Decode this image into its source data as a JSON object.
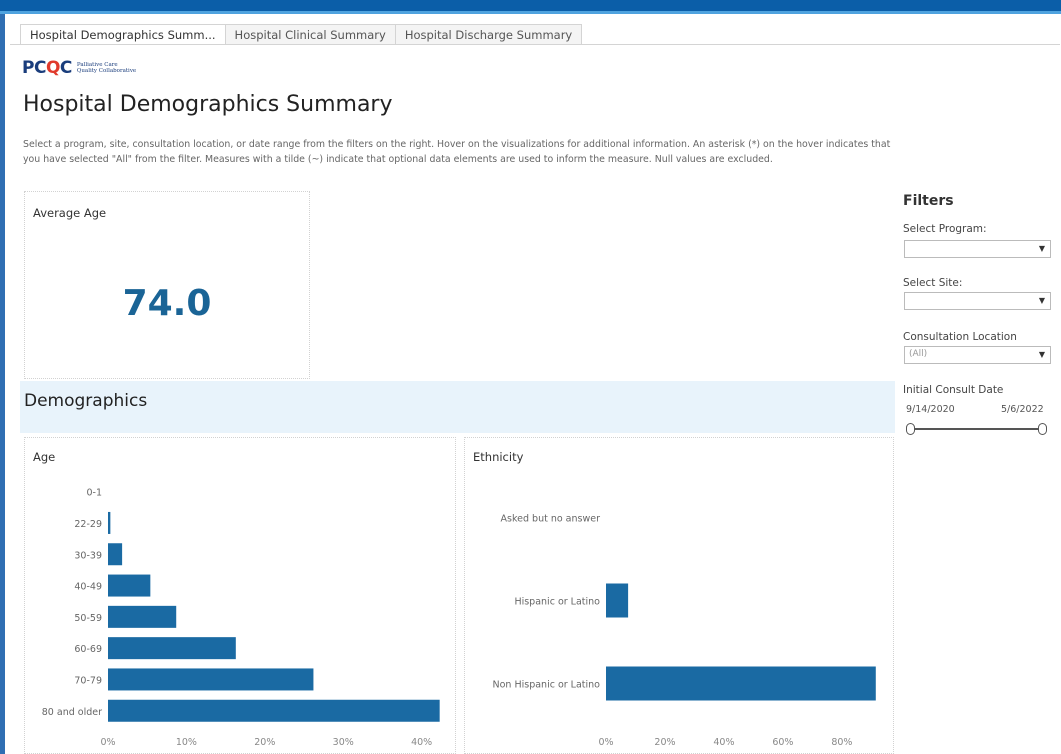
{
  "tabs": [
    {
      "label": "Hospital Demographics Summ...",
      "active": true
    },
    {
      "label": "Hospital Clinical Summary",
      "active": false
    },
    {
      "label": "Hospital Discharge Summary",
      "active": false
    }
  ],
  "logo": {
    "mark_a": "PC",
    "mark_b": "Q",
    "mark_c": "C",
    "line1": "Palliative Care",
    "line2": "Quality Collaborative"
  },
  "page_title": "Hospital Demographics Summary",
  "intro": "Select a program, site, consultation location, or date range from the filters on the right. Hover on the visualizations for additional information. An asterisk (*) on the hover indicates that you have selected \"All\" from the filter. Measures with a tilde (~) indicate that optional data elements are used to inform the measure. Null values are excluded.",
  "average_age": {
    "label": "Average Age",
    "value": "74.0"
  },
  "section_title": "Demographics",
  "filters": {
    "title": "Filters",
    "program": {
      "label": "Select Program:",
      "value": ""
    },
    "site": {
      "label": "Select Site:",
      "value": ""
    },
    "location": {
      "label": "Consultation Location",
      "value": "(All)"
    },
    "date": {
      "label": "Initial Consult Date",
      "start": "9/14/2020",
      "end": "5/6/2022",
      "start_fraction": 0,
      "end_fraction": 1
    }
  },
  "colors": {
    "bar": "#1a6aa3",
    "accent": "#0b5ea8",
    "band": "#e8f3fb"
  },
  "chart_data": [
    {
      "type": "bar",
      "orientation": "horizontal",
      "title": "Age",
      "categories": [
        "0-1",
        "22-29",
        "30-39",
        "40-49",
        "50-59",
        "60-69",
        "70-79",
        "80 and older"
      ],
      "values": [
        0,
        0.3,
        1.8,
        5.4,
        8.7,
        16.3,
        26.2,
        42.3
      ],
      "xlim": [
        0,
        44
      ],
      "xticks": [
        "0%",
        "10%",
        "20%",
        "30%",
        "40%"
      ],
      "xtick_values": [
        0,
        10,
        20,
        30,
        40
      ],
      "unit": "%"
    },
    {
      "type": "bar",
      "orientation": "horizontal",
      "title": "Ethnicity",
      "categories": [
        "Asked but no answer",
        "Hispanic or Latino",
        "Non Hispanic or Latino"
      ],
      "values": [
        0,
        7.5,
        91.5
      ],
      "xlim": [
        0,
        97
      ],
      "xticks": [
        "0%",
        "20%",
        "40%",
        "60%",
        "80%"
      ],
      "xtick_values": [
        0,
        20,
        40,
        60,
        80
      ],
      "unit": "%"
    }
  ]
}
